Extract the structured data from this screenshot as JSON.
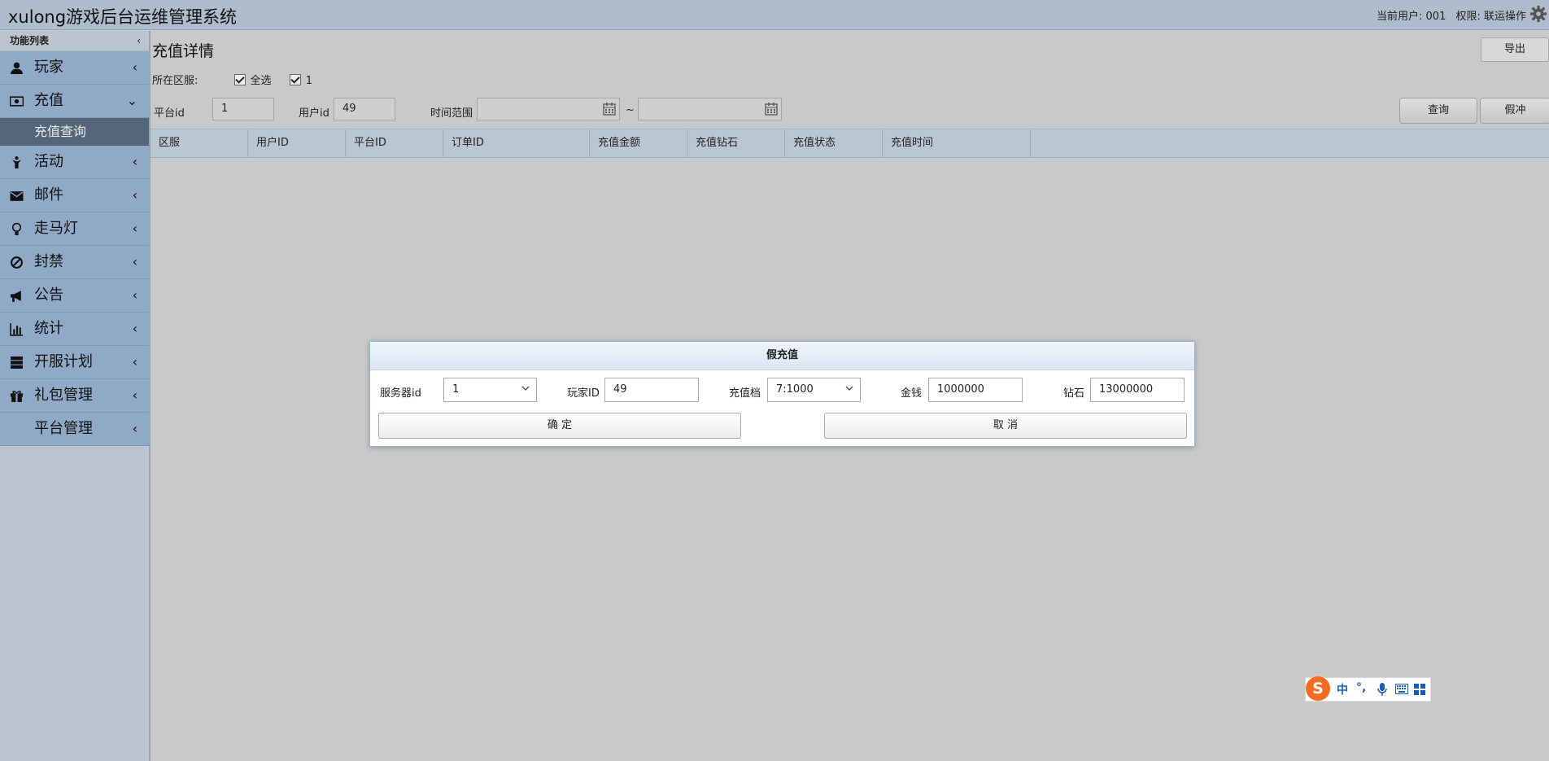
{
  "header": {
    "title": "xulong游戏后台运维管理系统",
    "current_user": "当前用户: 001",
    "permission": "权限: 联运操作"
  },
  "sidebar": {
    "heading": "功能列表",
    "items": [
      {
        "label": "玩家",
        "icon": "user-icon"
      },
      {
        "label": "充值",
        "icon": "money-icon",
        "expanded": true,
        "sub": [
          "充值查询"
        ]
      },
      {
        "label": "活动",
        "icon": "person-icon"
      },
      {
        "label": "邮件",
        "icon": "envelope-icon"
      },
      {
        "label": "走马灯",
        "icon": "lightbulb-icon"
      },
      {
        "label": "封禁",
        "icon": "ban-icon"
      },
      {
        "label": "公告",
        "icon": "bullhorn-icon"
      },
      {
        "label": "统计",
        "icon": "bar-chart-icon"
      },
      {
        "label": "开服计划",
        "icon": "server-icon"
      },
      {
        "label": "礼包管理",
        "icon": "gift-icon"
      },
      {
        "label": "平台管理",
        "icon": ""
      }
    ]
  },
  "main": {
    "title": "充值详情",
    "export_label": "导出",
    "region_label": "所在区服:",
    "region_all": "全选",
    "region_1": "1",
    "filters": {
      "platform_label": "平台id",
      "platform_value": "1",
      "user_label": "用户id",
      "user_value": "49",
      "time_label": "时间范围",
      "time_start": "",
      "time_end": "",
      "tilde": "~",
      "query_label": "查询",
      "fake_label": "假冲"
    },
    "columns": [
      "区服",
      "用户ID",
      "平台ID",
      "订单ID",
      "充值金额",
      "充值钻石",
      "充值状态",
      "充值时间"
    ]
  },
  "modal": {
    "title": "假充值",
    "server_label": "服务器id",
    "server_value": "1",
    "player_label": "玩家ID",
    "player_value": "49",
    "tier_label": "充值档",
    "tier_value": "7:1000",
    "gold_label": "金钱",
    "gold_value": "1000000",
    "diamond_label": "钻石",
    "diamond_value": "13000000",
    "confirm_label": "确 定",
    "cancel_label": "取 消"
  },
  "ime": {
    "logo": "S",
    "lang": "中",
    "punct": "°,"
  }
}
